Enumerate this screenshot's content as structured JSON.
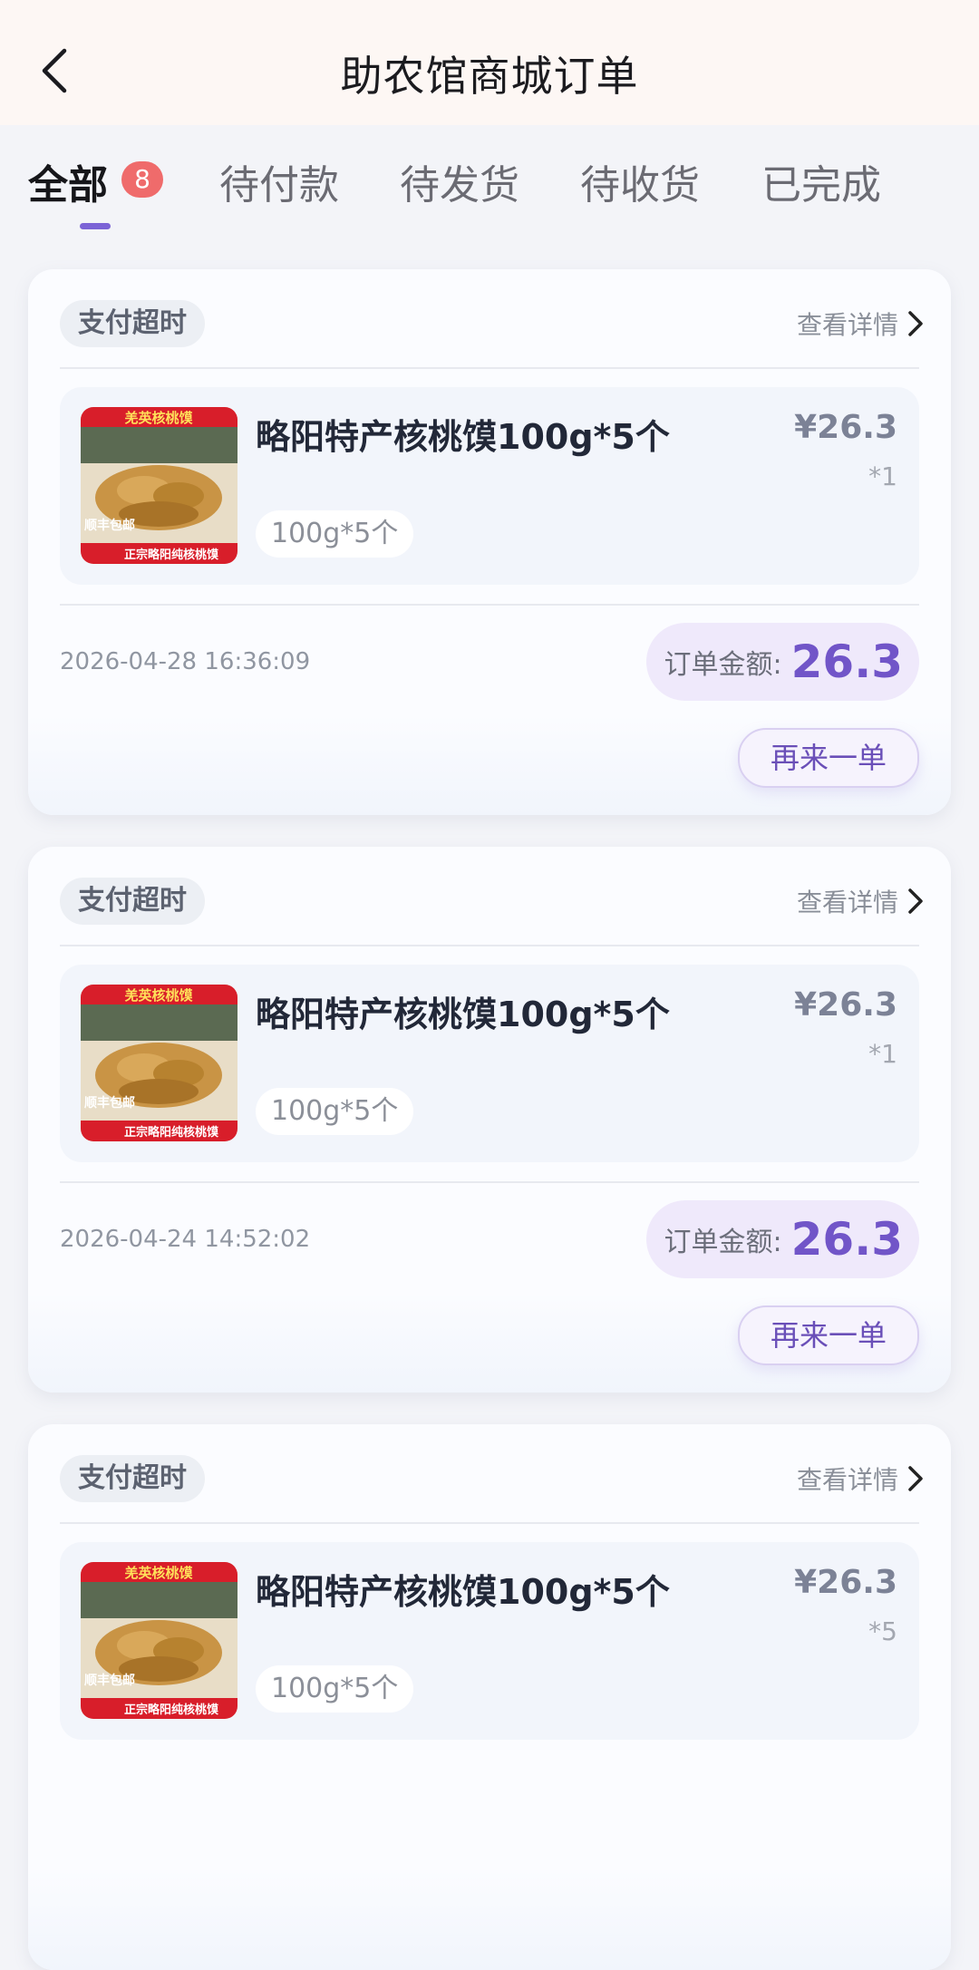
{
  "header": {
    "title": "助农馆商城订单",
    "back_icon": "chevron-left-icon"
  },
  "tabs": [
    {
      "label": "全部",
      "badge": "8",
      "active": true
    },
    {
      "label": "待付款"
    },
    {
      "label": "待发货"
    },
    {
      "label": "待收货"
    },
    {
      "label": "已完成"
    }
  ],
  "colors": {
    "accent": "#7155c8",
    "badge": "#ef6b6b",
    "header_bg": "#fdf7f4"
  },
  "orders": [
    {
      "status": "支付超时",
      "detail_label": "查看详情",
      "product": {
        "name": "略阳特产核桃馍100g*5个",
        "spec": "100g*5个",
        "price": "¥26.3",
        "qty": "*1",
        "image_icon": "walnut-bun-product-image",
        "image_text_top": "羌英核桃馍",
        "image_text_bottom": "正宗略阳纯核桃馍",
        "image_text_ship": "顺丰包邮"
      },
      "time": "2026-04-28 16:36:09",
      "amount_label": "订单金额:",
      "amount_value": "26.3",
      "reorder_label": "再来一单"
    },
    {
      "status": "支付超时",
      "detail_label": "查看详情",
      "product": {
        "name": "略阳特产核桃馍100g*5个",
        "spec": "100g*5个",
        "price": "¥26.3",
        "qty": "*1",
        "image_icon": "walnut-bun-product-image",
        "image_text_top": "羌英核桃馍",
        "image_text_bottom": "正宗略阳纯核桃馍",
        "image_text_ship": "顺丰包邮"
      },
      "time": "2026-04-24 14:52:02",
      "amount_label": "订单金额:",
      "amount_value": "26.3",
      "reorder_label": "再来一单"
    },
    {
      "status": "支付超时",
      "detail_label": "查看详情",
      "product": {
        "name": "略阳特产核桃馍100g*5个",
        "spec": "100g*5个",
        "price": "¥26.3",
        "qty": "*5",
        "image_icon": "walnut-bun-product-image",
        "image_text_top": "羌英核桃馍",
        "image_text_bottom": "正宗略阳纯核桃馍",
        "image_text_ship": "顺丰包邮"
      }
    }
  ]
}
